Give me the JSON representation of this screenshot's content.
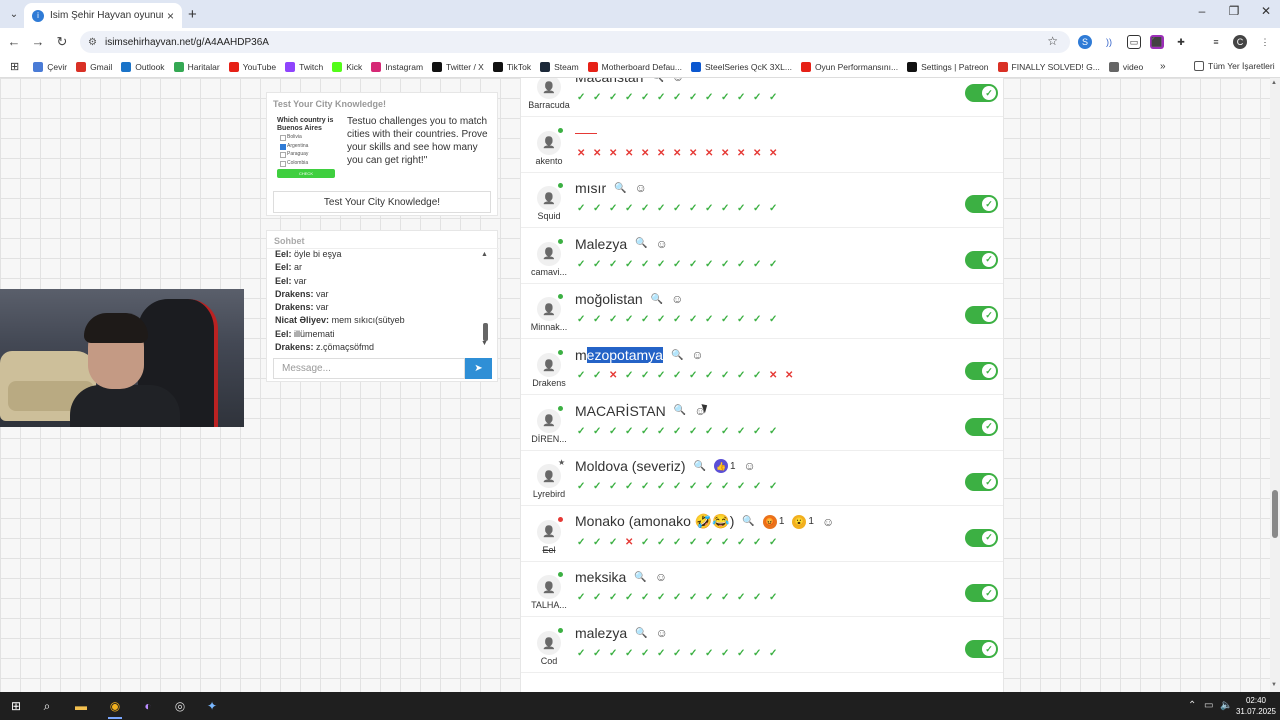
{
  "browser": {
    "tab_title": "İsim Şehir Hayvan oyununa katıl",
    "url": "isimsehirhayvan.net/g/A4AAHDP36A",
    "bookmarks": [
      {
        "label": "Çevir",
        "color": "#4a7bd6"
      },
      {
        "label": "Gmail",
        "color": "#d93025"
      },
      {
        "label": "Outlook",
        "color": "#1a73c8"
      },
      {
        "label": "Haritalar",
        "color": "#34a853"
      },
      {
        "label": "YouTube",
        "color": "#e62117"
      },
      {
        "label": "Twitch",
        "color": "#8f44fd"
      },
      {
        "label": "Kick",
        "color": "#53fc18"
      },
      {
        "label": "Instagram",
        "color": "#d62976"
      },
      {
        "label": "Twitter / X",
        "color": "#111111"
      },
      {
        "label": "TikTok",
        "color": "#111111"
      },
      {
        "label": "Steam",
        "color": "#1b2838"
      },
      {
        "label": "Motherboard Defau...",
        "color": "#e62117"
      },
      {
        "label": "SteelSeries QcK 3XL...",
        "color": "#0b57d0"
      },
      {
        "label": "Oyun Performansını...",
        "color": "#e62117"
      },
      {
        "label": "Settings | Patreon",
        "color": "#111111"
      },
      {
        "label": "FINALLY SOLVED! G...",
        "color": "#d93025"
      },
      {
        "label": "video",
        "color": "#666666"
      }
    ],
    "bookmarks_more": "»",
    "all_bookmarks": "Tüm Yer İşaretleri"
  },
  "ad": {
    "heading": "Test Your City Knowledge!",
    "quiz_question": "Which country is Buenos Aires",
    "quiz_options": [
      {
        "label": "Bolivia",
        "selected": false
      },
      {
        "label": "Argentina",
        "selected": true
      },
      {
        "label": "Paraguay",
        "selected": false
      },
      {
        "label": "Colombia",
        "selected": false
      }
    ],
    "quiz_check": "CHECK",
    "text": "Testuo challenges you to match cities with their countries. Prove your skills and see how many you can get right!\"",
    "button": "Test Your City Knowledge!"
  },
  "chat": {
    "heading": "Sohbet",
    "messages": [
      {
        "user": "Eel:",
        "text": "öyle bi eşya"
      },
      {
        "user": "Eel:",
        "text": "ar"
      },
      {
        "user": "Eel:",
        "text": "var"
      },
      {
        "user": "Drakens:",
        "text": "var"
      },
      {
        "user": "Drakens:",
        "text": "var"
      },
      {
        "user": "Nicat Əliyev:",
        "text": "mem sıkıcı(sütyeb"
      },
      {
        "user": "Eel:",
        "text": "illümemati"
      },
      {
        "user": "Drakens:",
        "text": "z.çömaçsöfmd"
      }
    ],
    "input_placeholder": "Message..."
  },
  "answers": [
    {
      "user": "Barracuda",
      "answer": "Macaristan",
      "online": true,
      "icons": true,
      "votes": "ccccccccccccc",
      "toggle": true
    },
    {
      "user": "akento",
      "answer": "",
      "online": true,
      "icons": false,
      "votes": "xxxxxxxxxxxxx",
      "toggle": false
    },
    {
      "user": "Squid",
      "answer": "mısır",
      "online": true,
      "icons": true,
      "votes": "ccccccccccccc",
      "toggle": true
    },
    {
      "user": "camavi...",
      "answer": "Malezya",
      "online": true,
      "icons": true,
      "votes": "ccccccccccccc",
      "toggle": true
    },
    {
      "user": "Minnak...",
      "answer": "moğolistan",
      "online": true,
      "icons": true,
      "votes": "ccccccccccccc",
      "toggle": true
    },
    {
      "user": "Drakens",
      "answer_pre": "m",
      "answer_hl": "ezopotamya",
      "online": true,
      "icons": true,
      "votes": "ccxcccccccccxx",
      "toggle": true
    },
    {
      "user": "DİREN...",
      "answer": "MACARİSTAN",
      "online": true,
      "icons": true,
      "votes": "ccccccccccccc",
      "toggle": true
    },
    {
      "user": "Lyrebird",
      "answer": "Moldova (severiz)",
      "online": false,
      "star": true,
      "icons": true,
      "reactions": [
        {
          "emoji": "👍",
          "count": "1",
          "color": "#5b4fd6"
        }
      ],
      "votes": "ccccccccccccc",
      "toggle": true
    },
    {
      "user": "Eel",
      "answer": "Monako (amonako 🤣😂)",
      "online": false,
      "strike": true,
      "icons": true,
      "reactions": [
        {
          "emoji": "😡",
          "count": "1",
          "color": "#e8731c"
        },
        {
          "emoji": "😮",
          "count": "1",
          "color": "#f2b01e"
        }
      ],
      "votes": "cccxccccccccc",
      "toggle": true
    },
    {
      "user": "TALHA...",
      "answer": "meksika",
      "online": true,
      "icons": true,
      "votes": "ccccccccccccc",
      "toggle": true
    },
    {
      "user": "Cod",
      "answer": "malezya",
      "online": true,
      "icons": true,
      "votes": "ccccccccccccc",
      "toggle": true
    }
  ],
  "taskbar": {
    "time": "02:40",
    "date": "31.07.2025"
  }
}
